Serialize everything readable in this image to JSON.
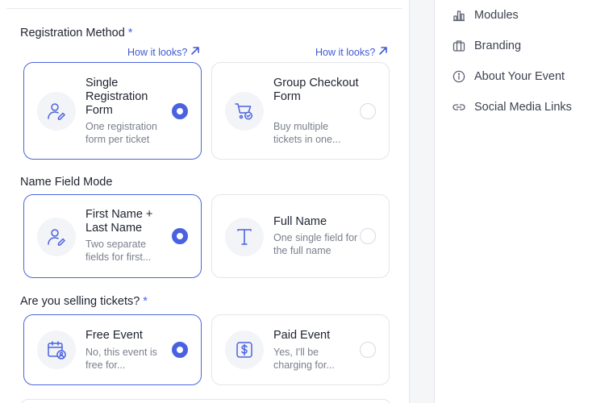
{
  "registration_method": {
    "title": "Registration Method",
    "required_mark": "*",
    "options": [
      {
        "title": "Single Registration Form",
        "description": "One registration form per ticket",
        "how_link": "How it looks?",
        "selected": true,
        "icon": "user-edit-icon"
      },
      {
        "title": "Group Checkout Form",
        "description": "Buy multiple tickets in one...",
        "how_link": "How it looks?",
        "selected": false,
        "icon": "cart-check-icon"
      }
    ]
  },
  "name_field_mode": {
    "title": "Name Field Mode",
    "options": [
      {
        "title": "First Name + Last Name",
        "description": "Two separate fields for first...",
        "selected": true,
        "icon": "user-edit-icon"
      },
      {
        "title": "Full Name",
        "description": "One single field for the full name",
        "selected": false,
        "icon": "text-t-icon"
      }
    ]
  },
  "selling_tickets": {
    "title": "Are you selling tickets?",
    "required_mark": "*",
    "options": [
      {
        "title": "Free Event",
        "description": "No, this event is free for...",
        "selected": true,
        "icon": "calendar-user-icon"
      },
      {
        "title": "Paid Event",
        "description": "Yes, I'll be charging for...",
        "selected": false,
        "icon": "dollar-icon"
      }
    ]
  },
  "sidebar": {
    "items": [
      {
        "label": "Modules",
        "icon": "bar-chart-icon"
      },
      {
        "label": "Branding",
        "icon": "briefcase-icon"
      },
      {
        "label": "About Your Event",
        "icon": "info-icon"
      },
      {
        "label": "Social Media Links",
        "icon": "link-icon"
      }
    ]
  },
  "colors": {
    "accent": "#4a62e0",
    "border": "#e3e5ea",
    "muted_text": "#7a7f8c"
  }
}
